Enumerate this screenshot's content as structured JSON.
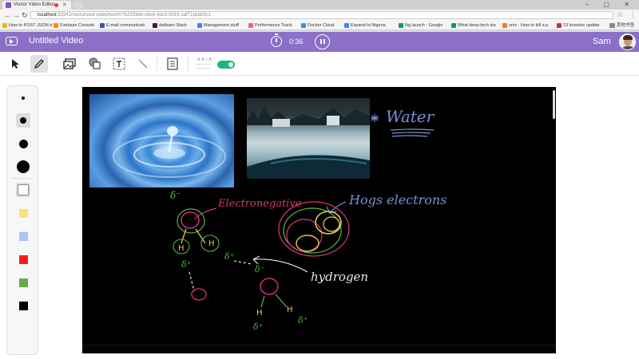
{
  "browser": {
    "tab_title": "Vector Video Editor",
    "window_controls": "– ▢ ✕",
    "address": {
      "host": "localhost",
      "path": ":63342/vectorized-video/test/#/7b2233de-c8e6-4dc3-9019-1af71dcbd3c1"
    },
    "bookmarks": [
      {
        "label": "How to POST JSON d",
        "color": "#f4b400"
      },
      {
        "label": "Firebase Console",
        "color": "#ff8f00"
      },
      {
        "label": "E-mail communicati",
        "color": "#3f51b5"
      },
      {
        "label": "dotlearn Slack",
        "color": "#4a154b"
      },
      {
        "label": "Management stuff",
        "color": "#4285f4"
      },
      {
        "label": "Performance Track",
        "color": "#f06292"
      },
      {
        "label": "Docker Cloud",
        "color": "#2496ed"
      },
      {
        "label": "Expand to Nigeria",
        "color": "#4285f4"
      },
      {
        "label": "Ng launch - Google",
        "color": "#0f9d58"
      },
      {
        "label": "What deep-tech sta",
        "color": "#0f9d58"
      },
      {
        "label": "unix - How to kill a p",
        "color": "#f48024"
      },
      {
        "label": "13 Investor update",
        "color": "#d32f2f"
      }
    ],
    "other_bookmarks": "其他书签"
  },
  "app": {
    "title": "Untitled Video",
    "time": "0:36",
    "user": "Sam"
  },
  "toolbar": {
    "text_style_sample": "A A i A",
    "toggle_on": true,
    "toggle_color": "#1bb87a",
    "active_tool": "pen"
  },
  "palette": {
    "sizes": [
      "small",
      "medium",
      "large",
      "xlarge"
    ],
    "colors": [
      "#ffe07a",
      "#a8c6f5",
      "#ff1a1a",
      "#6aaa4a",
      "#000000"
    ]
  },
  "canvas": {
    "annotations": {
      "water": "Water",
      "electronegative": "Electronegative",
      "hogs": "Hogs electrons",
      "hydrogen": "hydrogen"
    }
  },
  "theme": {
    "accent": "#8c6fc7"
  }
}
